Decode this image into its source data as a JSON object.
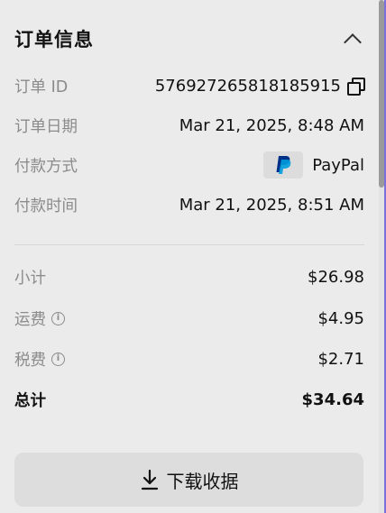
{
  "header": {
    "title": "订单信息",
    "collapse_icon": "chevron-up-icon"
  },
  "details": {
    "order_id": {
      "label": "订单 ID",
      "value": "576927265818185915"
    },
    "order_date": {
      "label": "订单日期",
      "value": "Mar 21, 2025, 8:48 AM"
    },
    "payment_method": {
      "label": "付款方式",
      "value": "PayPal"
    },
    "payment_time": {
      "label": "付款时间",
      "value": "Mar 21, 2025, 8:51 AM"
    }
  },
  "summary": {
    "subtotal": {
      "label": "小计",
      "value": "$26.98"
    },
    "shipping": {
      "label": "运费",
      "value": "$4.95"
    },
    "tax": {
      "label": "税费",
      "value": "$2.71"
    },
    "total": {
      "label": "总计",
      "value": "$34.64"
    }
  },
  "download_button": {
    "label": "下载收据"
  },
  "colors": {
    "background": "#ebebeb",
    "paypal_dark_blue": "#003087",
    "paypal_light_blue": "#009cde",
    "accent_edge": "#7b70d8"
  }
}
